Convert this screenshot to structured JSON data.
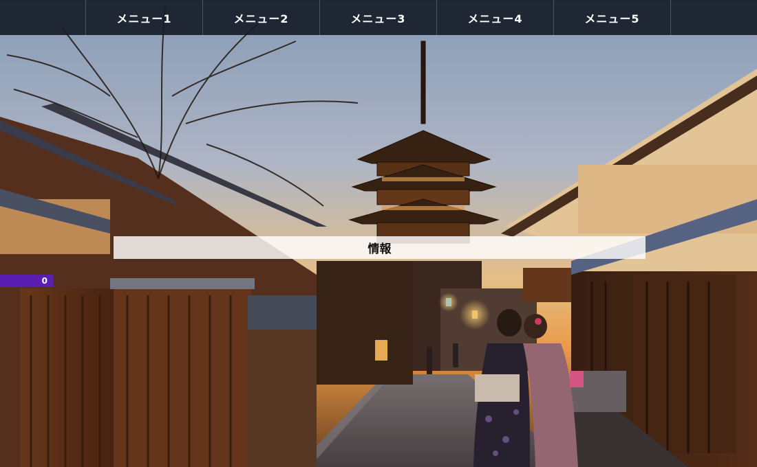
{
  "nav": {
    "items": [
      {
        "label": "メニュー1"
      },
      {
        "label": "メニュー2"
      },
      {
        "label": "メニュー3"
      },
      {
        "label": "メニュー4"
      },
      {
        "label": "メニュー5"
      }
    ]
  },
  "info_bar": {
    "label": "情報"
  },
  "counter": {
    "value": "0"
  },
  "hero_image": {
    "alt": "Kyoto street with pagoda at dusk"
  }
}
